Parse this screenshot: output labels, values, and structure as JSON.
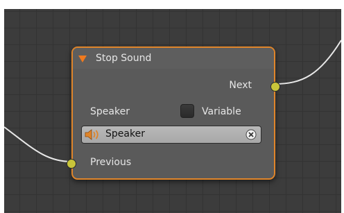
{
  "node": {
    "title": "Stop Sound",
    "output_label": "Next",
    "speaker_label": "Speaker",
    "variable_label": "Variable",
    "variable_checked": false,
    "speaker_field": {
      "value": "Speaker",
      "icon": "speaker-icon"
    },
    "input_label": "Previous"
  },
  "colors": {
    "canvas": "#3c3c3c",
    "grid": "#333333",
    "node_body": "#5a5a5a",
    "node_border": "#e0852a",
    "collapse_arrow": "#f07a1e",
    "socket": "#c9c53a",
    "wire": "#e8e8e8"
  }
}
